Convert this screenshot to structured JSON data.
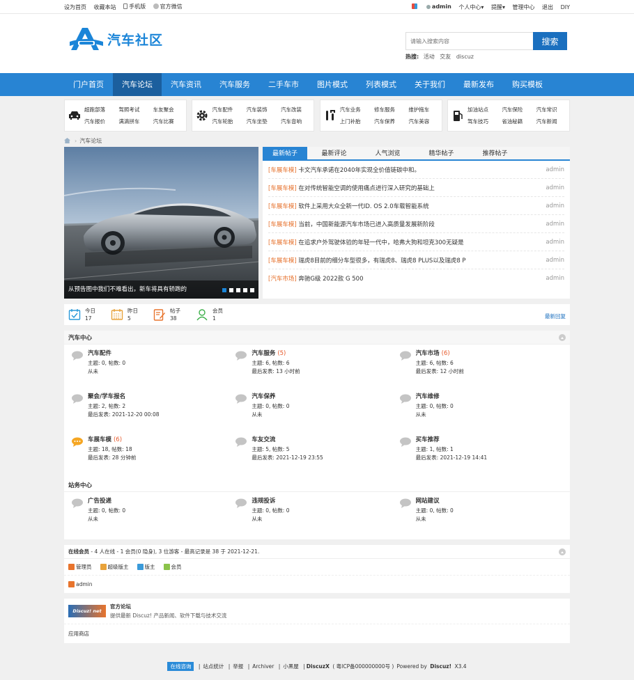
{
  "topbar": {
    "left": [
      "设为首页",
      "收藏本站",
      "手机版",
      "官方微信"
    ],
    "user": "admin",
    "right": [
      "个人中心",
      "提醒",
      "管理中心",
      "退出",
      "DIY"
    ]
  },
  "header": {
    "logo_text": "汽车社区",
    "search_placeholder": "请输入搜索内容",
    "search_button": "搜索",
    "hot_label": "热搜:",
    "hot_words": [
      "活动",
      "交友",
      "discuz"
    ]
  },
  "nav": [
    "门户首页",
    "汽车论坛",
    "汽车资讯",
    "汽车服务",
    "二手车市",
    "图片模式",
    "列表模式",
    "关于我们",
    "最新发布",
    "购买模板"
  ],
  "categories": [
    {
      "icon": "car-icon",
      "items": [
        "超跑部落",
        "驾照考试",
        "车友聚会",
        "汽车报价",
        "满滴拼车",
        "汽车比赛"
      ]
    },
    {
      "icon": "gear-icon",
      "items": [
        "汽车配件",
        "汽车装饰",
        "汽车改装",
        "汽车轮胎",
        "汽车坐垫",
        "汽车音响"
      ]
    },
    {
      "icon": "tools-icon",
      "items": [
        "汽车业务",
        "修车服务",
        "维护拖车",
        "上门补胎",
        "汽车保养",
        "汽车美容"
      ]
    },
    {
      "icon": "fuel-icon",
      "items": [
        "加油站点",
        "汽车保险",
        "汽车常识",
        "驾车技巧",
        "省油秘籍",
        "汽车新闻"
      ]
    }
  ],
  "breadcrumb": "汽车论坛",
  "slide": {
    "caption": "从预告图中我们不难看出，新车将具有轿跑的"
  },
  "tabs": {
    "labels": [
      "最新帖子",
      "最新评论",
      "人气浏览",
      "精华帖子",
      "推荐帖子"
    ],
    "posts": [
      {
        "tag": "[车展车模]",
        "title": "卡文汽车承诺在2040年实现全价值链碳中和。",
        "author": "admin"
      },
      {
        "tag": "[车展车模]",
        "title": "在对传统智能空调的使用痛点进行深入研究的基础上",
        "author": "admin"
      },
      {
        "tag": "[车展车模]",
        "title": "软件上采用大众全新一代ID. OS 2.0车载智能系统",
        "author": "admin"
      },
      {
        "tag": "[车展车模]",
        "title": "当前，中国新能源汽车市场已进入高质量发展新阶段",
        "author": "admin"
      },
      {
        "tag": "[车展车模]",
        "title": "在追求户外驾驶体验的年轻一代中，哈弗大狗和坦克300无疑是",
        "author": "admin"
      },
      {
        "tag": "[车展车模]",
        "title": "瑞虎8目前的细分车型很多，有瑞虎8、瑞虎8 PLUS以及瑞虎8 P",
        "author": "admin"
      },
      {
        "tag": "[汽车市场]",
        "title": "奔驰G级 2022款 G 500",
        "author": "admin"
      }
    ]
  },
  "stats": {
    "items": [
      {
        "label": "今日",
        "value": "17"
      },
      {
        "label": "昨日",
        "value": "5"
      },
      {
        "label": "帖子",
        "value": "38"
      },
      {
        "label": "会员",
        "value": "1"
      }
    ],
    "latest": "最新回复"
  },
  "groups": [
    {
      "title": "汽车中心",
      "forums": [
        {
          "name": "汽车配件",
          "count": "",
          "l1": "主题: 0, 帖数: 0",
          "l2": "从未",
          "hot": false
        },
        {
          "name": "汽车服务",
          "count": "(5)",
          "l1": "主题: 6, 帖数: 6",
          "l2": "最后发表: 13 小时前",
          "hot": false
        },
        {
          "name": "汽车市场",
          "count": "(6)",
          "l1": "主题: 6, 帖数: 6",
          "l2": "最后发表: 12 小时前",
          "hot": false
        },
        {
          "name": "聚会/学车报名",
          "count": "",
          "l1": "主题: 2, 帖数: 2",
          "l2": "最后发表: 2021-12-20 00:08",
          "hot": false
        },
        {
          "name": "汽车保养",
          "count": "",
          "l1": "主题: 0, 帖数: 0",
          "l2": "从未",
          "hot": false
        },
        {
          "name": "汽车维修",
          "count": "",
          "l1": "主题: 0, 帖数: 0",
          "l2": "从未",
          "hot": false
        },
        {
          "name": "车展车模",
          "count": "(6)",
          "l1": "主题: 18, 帖数: 18",
          "l2": "最后发表: 28 分钟前",
          "hot": true
        },
        {
          "name": "车友交流",
          "count": "",
          "l1": "主题: 5, 帖数: 5",
          "l2": "最后发表: 2021-12-19 23:55",
          "hot": false
        },
        {
          "name": "买车推荐",
          "count": "",
          "l1": "主题: 1, 帖数: 1",
          "l2": "最后发表: 2021-12-19 14:41",
          "hot": false
        }
      ]
    },
    {
      "title": "站务中心",
      "forums": [
        {
          "name": "广告投递",
          "count": "",
          "l1": "主题: 0, 帖数: 0",
          "l2": "从未",
          "hot": false
        },
        {
          "name": "违规投诉",
          "count": "",
          "l1": "主题: 0, 帖数: 0",
          "l2": "从未",
          "hot": false
        },
        {
          "name": "网站建议",
          "count": "",
          "l1": "主题: 0, 帖数: 0",
          "l2": "从未",
          "hot": false
        }
      ]
    }
  ],
  "online": {
    "prefix": "在线会员",
    "text": " - 4 人在线 - 1 会员(0 隐身), 3 位游客 - 最高记录是 38 于 2021-12-21.",
    "legend": [
      {
        "label": "管理员",
        "color": "#e8742d"
      },
      {
        "label": "超级版主",
        "color": "#e8a23a"
      },
      {
        "label": "版主",
        "color": "#3a9ad9"
      },
      {
        "label": "会员",
        "color": "#8bc34a"
      }
    ],
    "user": "admin"
  },
  "links": {
    "logo_text": "Discuz! net",
    "title": "官方论坛",
    "desc": "提供最新 Discuz! 产品新闻、软件下载与技术交流",
    "shop": "应用商店"
  },
  "footer": {
    "consult": "在线咨询",
    "items": [
      "站点统计",
      "举报",
      "Archiver",
      "小黑屋"
    ],
    "brand": "DiscuzX",
    "icp": "( 粤ICP备000000000号 )",
    "powered": "Powered by",
    "product": "Discuz!",
    "version": "X3.4"
  }
}
